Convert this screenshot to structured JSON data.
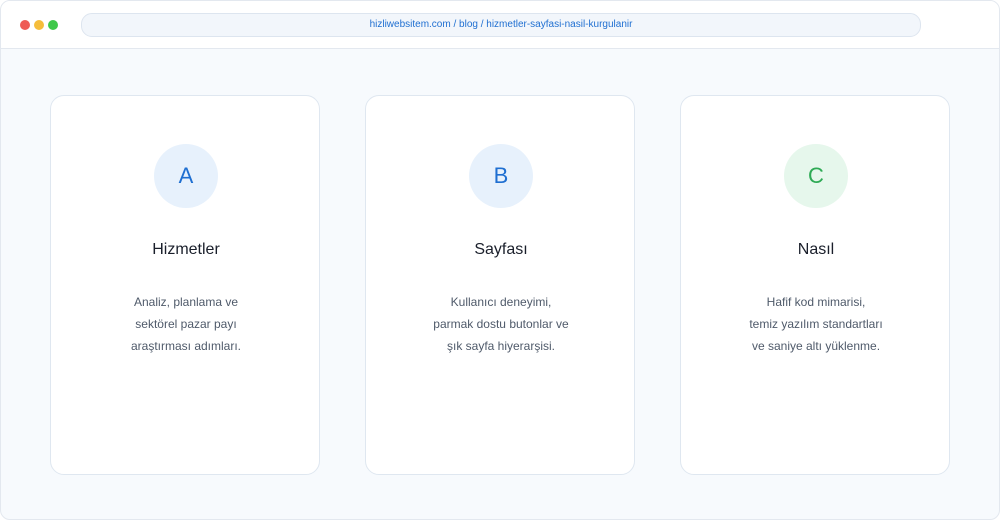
{
  "browser": {
    "url": "hizliwebsitem.com / blog / hizmetler-sayfasi-nasil-kurgulanir"
  },
  "cards": [
    {
      "letter": "A",
      "title": "Hizmetler",
      "lines": [
        "Analiz, planlama ve",
        "sektörel pazar payı",
        "araştırması adımları."
      ],
      "accent": "#1f6fd1"
    },
    {
      "letter": "B",
      "title": "Sayfası",
      "lines": [
        "Kullanıcı deneyimi,",
        "parmak dostu butonlar ve",
        "şık sayfa hiyerarşisi."
      ],
      "accent": "#1f6fd1"
    },
    {
      "letter": "C",
      "title": "Nasıl",
      "lines": [
        "Hafif kod mimarisi,",
        "temiz yazılım standartları",
        "ve saniye altı yüklenme."
      ],
      "accent": "#2eaa55"
    }
  ]
}
